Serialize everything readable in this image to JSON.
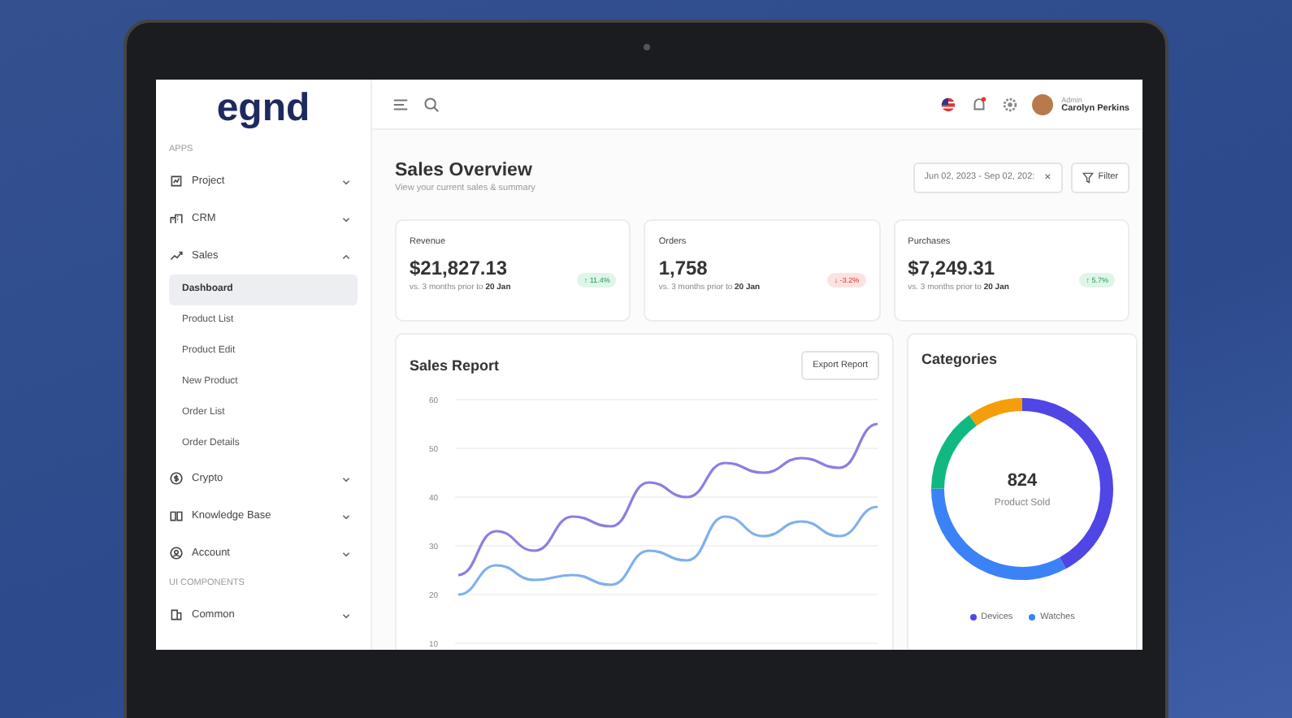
{
  "sidebar": {
    "logo": "egnd",
    "sections": [
      {
        "title": "APPS",
        "items": [
          {
            "label": "Project",
            "expanded": false
          },
          {
            "label": "CRM",
            "expanded": false
          },
          {
            "label": "Sales",
            "expanded": true,
            "children": [
              {
                "label": "Dashboard",
                "selected": true
              },
              {
                "label": "Product List",
                "selected": false
              },
              {
                "label": "Product Edit",
                "selected": false
              },
              {
                "label": "New Product",
                "selected": false
              },
              {
                "label": "Order List",
                "selected": false
              },
              {
                "label": "Order Details",
                "selected": false
              }
            ]
          },
          {
            "label": "Crypto",
            "expanded": false
          },
          {
            "label": "Knowledge Base",
            "expanded": false
          },
          {
            "label": "Account",
            "expanded": false
          }
        ]
      },
      {
        "title": "UI COMPONENTS",
        "items": [
          {
            "label": "Common",
            "expanded": false
          }
        ]
      }
    ]
  },
  "topbar": {
    "user_role": "Admin",
    "user_name": "Carolyn Perkins"
  },
  "header": {
    "title": "Sales Overview",
    "subtitle": "View your current sales & summary",
    "date_range": "Jun 02, 2023 - Sep 02, 202:",
    "clear": "×",
    "filter": "Filter"
  },
  "stats": [
    {
      "label": "Revenue",
      "value": "$21,827.13",
      "change": "↑ 11.4%",
      "positive": true,
      "note": "vs. 3 months prior to **20 Jan**"
    },
    {
      "label": "Orders",
      "value": "1,758",
      "change": "↓ -3.2%",
      "positive": false,
      "note": "vs. 3 months prior to **20 Jan**"
    },
    {
      "label": "Purchases",
      "value": "$7,249.31",
      "change": "↑ 5.7%",
      "positive": true,
      "note": "vs. 3 months prior to **20 Jan**"
    }
  ],
  "sales_report": {
    "title": "Sales Report",
    "export": "Export Report",
    "chart_data": {
      "type": "line",
      "grid": true,
      "yticks": [
        10,
        20,
        30,
        40,
        50,
        60
      ],
      "ylim": [
        10,
        60
      ],
      "series": [
        {
          "color": "#8b7fe0",
          "values": [
            24,
            33,
            29,
            36,
            34,
            43,
            40,
            47,
            45,
            48,
            46,
            55
          ]
        },
        {
          "color": "#7fb0ee",
          "values": [
            20,
            26,
            23,
            24,
            22,
            29,
            27,
            36,
            32,
            35,
            32,
            38
          ]
        }
      ]
    }
  },
  "categories": {
    "title": "Categories",
    "total": "824",
    "total_label": "Product Sold",
    "legend": [
      {
        "label": "Devices",
        "color": "#4f46e5"
      },
      {
        "label": "Watches",
        "color": "#3b82f6"
      }
    ]
  }
}
